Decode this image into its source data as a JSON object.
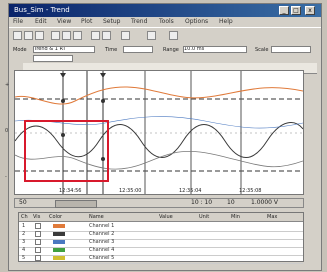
{
  "window": {
    "title": "Bus_Sim - Trend",
    "controls": [
      "_",
      "□",
      "x"
    ]
  },
  "menu": {
    "items": [
      "File",
      "Edit",
      "View",
      "Plot",
      "Setup",
      "Trend",
      "Tools",
      "Options",
      "Help"
    ]
  },
  "toolbar": {
    "icons": [
      "open-icon",
      "save-icon",
      "print-icon",
      "cut-icon",
      "copy-icon",
      "paste-icon",
      "zoom-in-icon",
      "zoom-out-icon",
      "cursor-icon",
      "grid-icon",
      "pan-icon"
    ]
  },
  "fields": {
    "mode_label": "Mode",
    "mode_value": "Trend & 1 RT",
    "time_label": "Time",
    "range_label": "Range",
    "range_value": "10.0 ms",
    "scale_label": "Scale"
  },
  "plot": {
    "y_labels": [
      "+",
      "0",
      "-"
    ],
    "time_ticks": [
      "12:34:56",
      "12:35:00",
      "12:35:04",
      "12:35:08"
    ],
    "series_colors": {
      "trace1": "#e07a3a",
      "trace2": "#3a3a3a",
      "trace3": "#7a7a7a",
      "trace4": "#4a78c0"
    }
  },
  "status": {
    "left": "50",
    "mid": "10 : 10",
    "right": "10",
    "readout": "1.0000 V"
  },
  "table": {
    "headers": [
      "Ch",
      "Vis",
      "Color",
      "Name",
      "Value",
      "Unit",
      "Min",
      "Max"
    ],
    "rows": [
      {
        "ch": "1",
        "color": "#e07a3a",
        "name": "Channel 1"
      },
      {
        "ch": "2",
        "color": "#3a3a3a",
        "name": "Channel 2"
      },
      {
        "ch": "3",
        "color": "#4a78c0",
        "name": "Channel 3"
      },
      {
        "ch": "4",
        "color": "#40a040",
        "name": "Channel 4"
      },
      {
        "ch": "5",
        "color": "#d0c030",
        "name": "Channel 5"
      }
    ]
  },
  "highlight": {
    "color": "#d8192c"
  }
}
